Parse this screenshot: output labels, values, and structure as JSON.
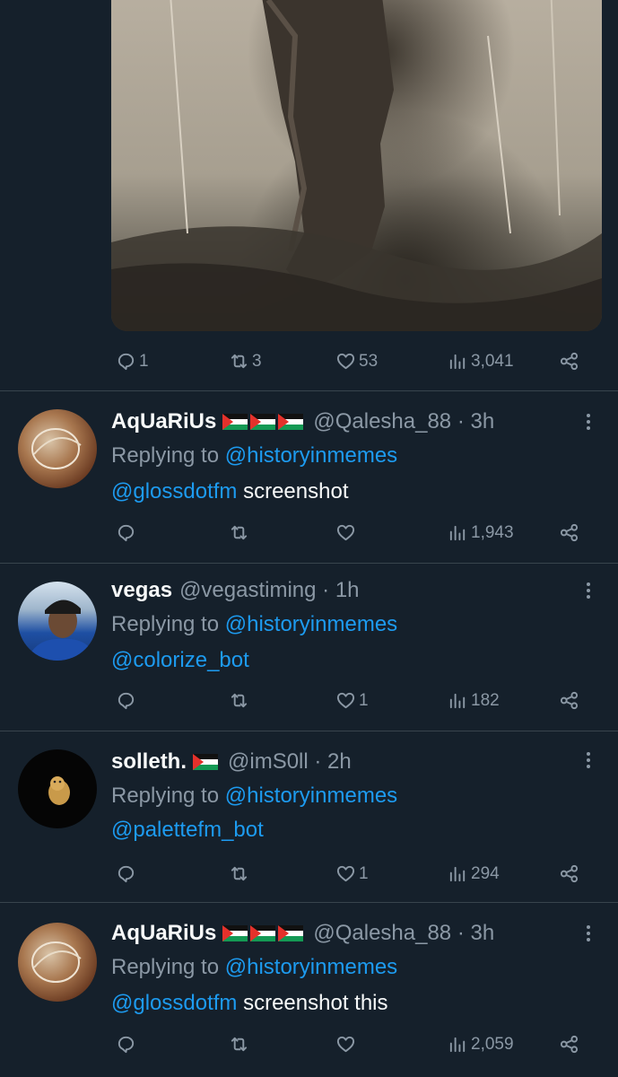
{
  "top_tweet": {
    "image_alt": "historical photo",
    "stats": {
      "replies": "1",
      "retweets": "3",
      "likes": "53",
      "views": "3,041"
    }
  },
  "replies": [
    {
      "name": "AqUaRiUs",
      "flags": [
        "palestine-flag",
        "palestine-flag",
        "palestine-flag"
      ],
      "handle": "@Qalesha_88 · 3h",
      "replying_prefix": "Replying to ",
      "replying_to": "@historyinmemes",
      "mention": "@glossdotfm",
      "text": " screenshot",
      "stats": {
        "replies": "",
        "retweets": "",
        "likes": "",
        "views": "1,943"
      }
    },
    {
      "name": "vegas",
      "flags": [],
      "handle": "@vegastiming · 1h",
      "replying_prefix": "Replying to ",
      "replying_to": "@historyinmemes",
      "mention": "@colorize_bot",
      "text": "",
      "stats": {
        "replies": "",
        "retweets": "",
        "likes": "1",
        "views": "182"
      }
    },
    {
      "name": "solleth.",
      "flags": [
        "palestine-flag"
      ],
      "handle": "@imS0ll · 2h",
      "replying_prefix": "Replying to ",
      "replying_to": "@historyinmemes",
      "mention": "@palettefm_bot",
      "text": "",
      "stats": {
        "replies": "",
        "retweets": "",
        "likes": "1",
        "views": "294"
      }
    },
    {
      "name": "AqUaRiUs",
      "flags": [
        "palestine-flag",
        "palestine-flag",
        "palestine-flag"
      ],
      "handle": "@Qalesha_88 · 3h",
      "replying_prefix": "Replying to ",
      "replying_to": "@historyinmemes",
      "mention": "@glossdotfm",
      "text": " screenshot this",
      "stats": {
        "replies": "",
        "retweets": "",
        "likes": "",
        "views": "2,059"
      }
    }
  ],
  "colors": {
    "background": "#15202b",
    "link": "#1d9bf0",
    "muted": "#8b98a5",
    "divider": "#38444d"
  }
}
